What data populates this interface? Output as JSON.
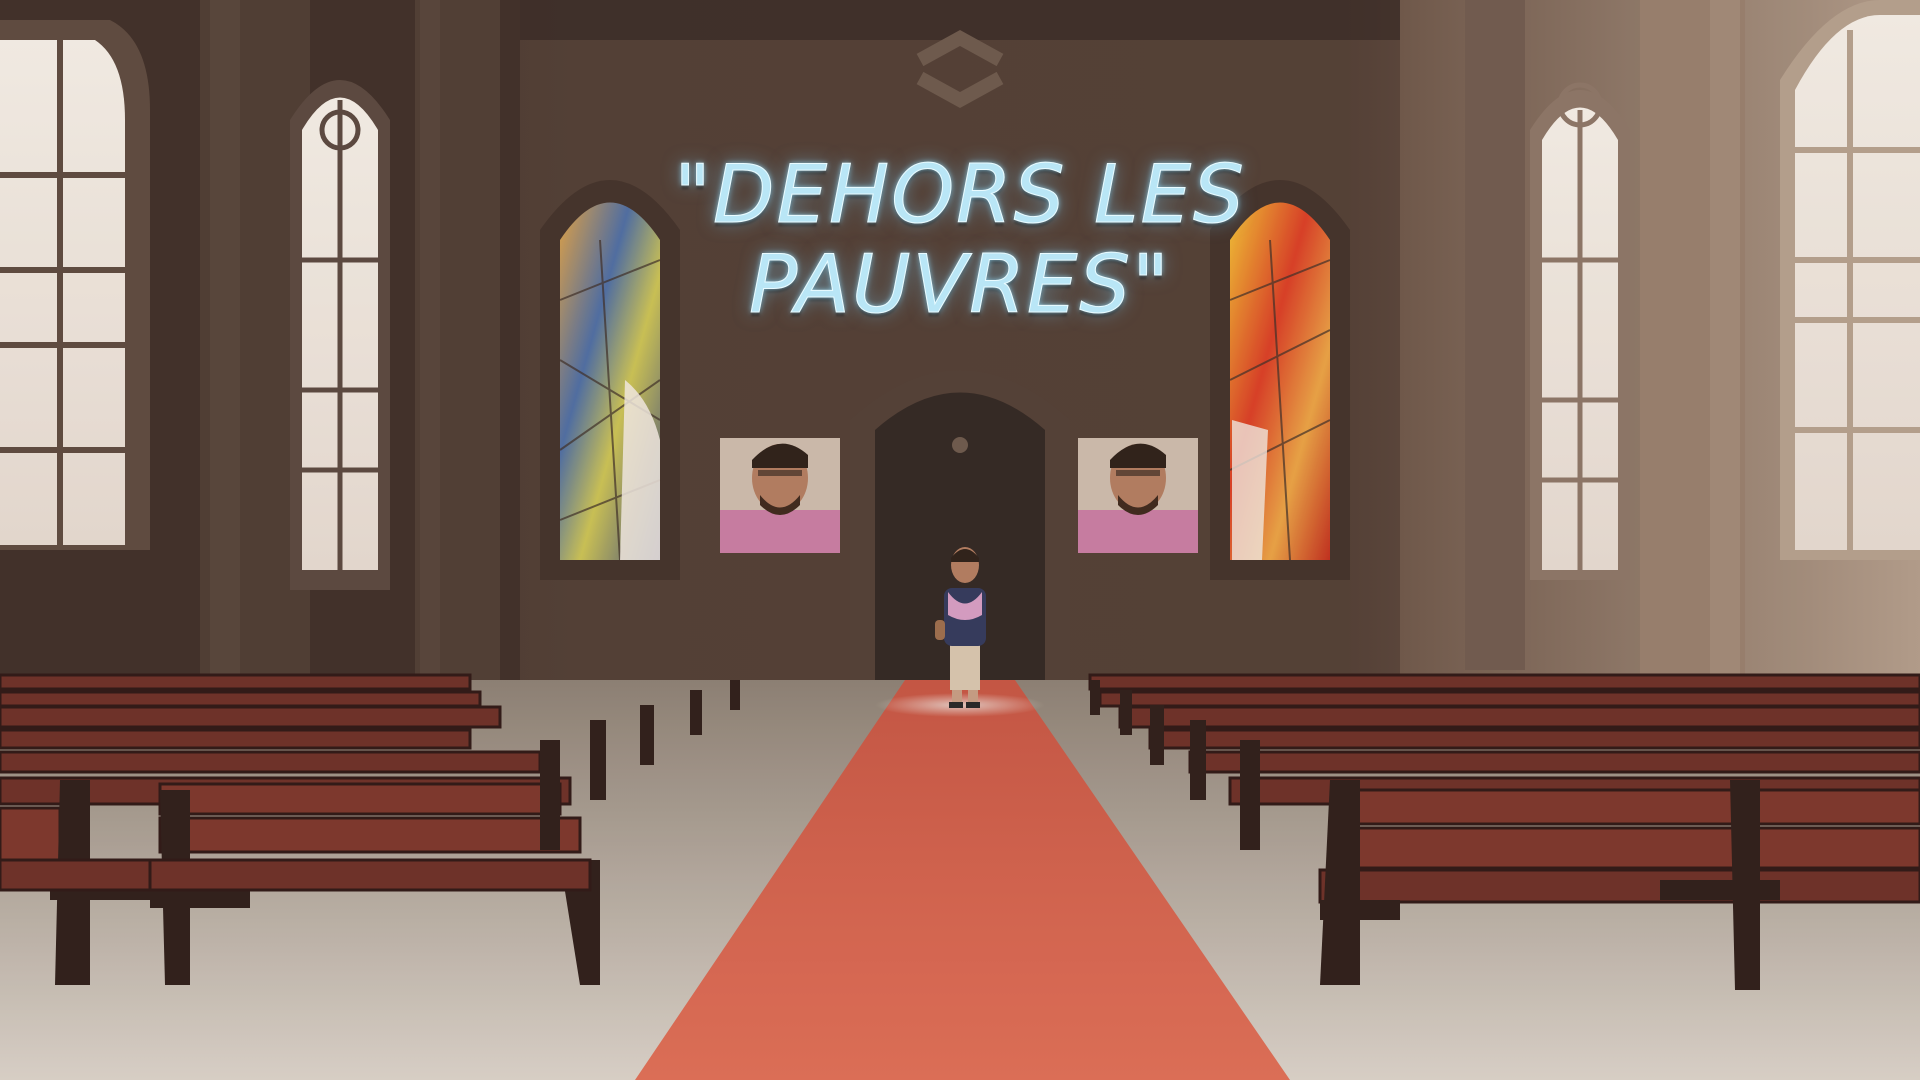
{
  "scene": {
    "title_line1": "\"DEHORS LES",
    "title_line2": "PAUVRES\"",
    "logo": "hexagon-logo-icon",
    "colors": {
      "wall": "#4a372d",
      "carpet": "#c95a45",
      "floor": "#cfc6bb",
      "pew": "#6e2e24",
      "neon": "#b9e6f6"
    }
  }
}
